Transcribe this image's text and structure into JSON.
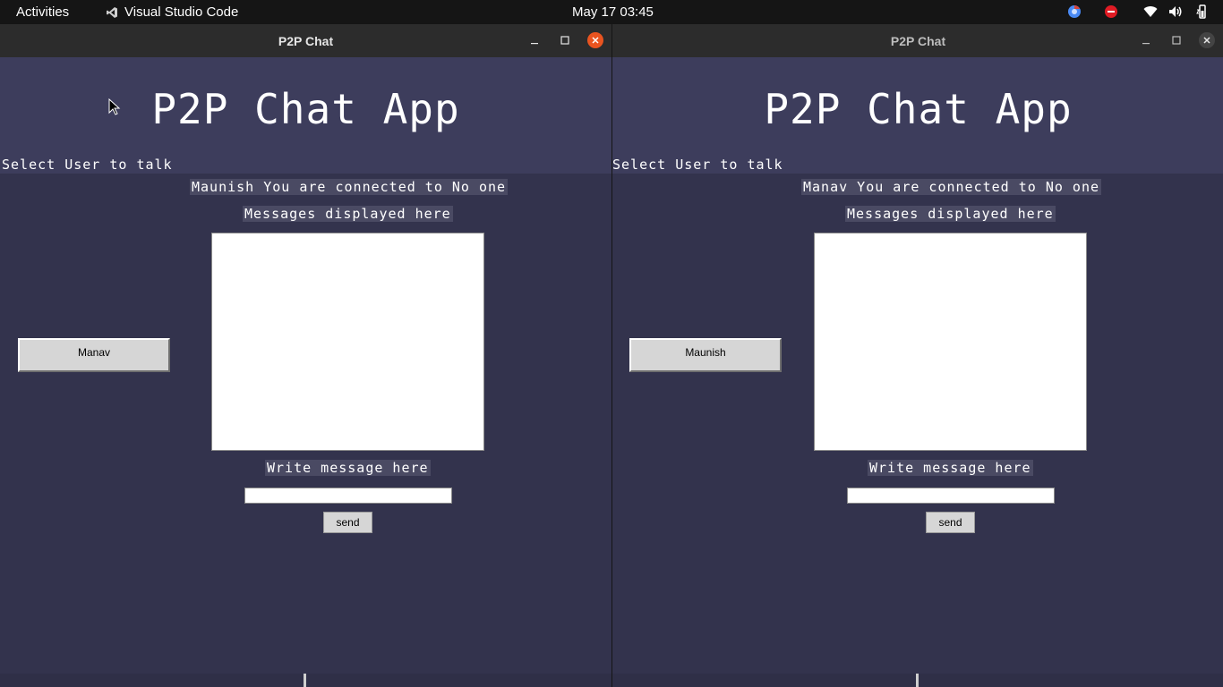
{
  "topbar": {
    "activities": "Activities",
    "app_name": "Visual Studio Code",
    "clock": "May 17  03:45"
  },
  "windows": [
    {
      "title": "P2P Chat",
      "app_title": "P2P Chat App",
      "select_label": "Select User to talk",
      "status": "Maunish You are connected to No one",
      "messages_label": "Messages displayed here",
      "user_button": "Manav",
      "write_label": "Write message here",
      "message_input_value": "",
      "send_label": "send"
    },
    {
      "title": "P2P Chat",
      "app_title": "P2P Chat App",
      "select_label": "Select User to talk",
      "status": "Manav You are connected to No one",
      "messages_label": "Messages displayed here",
      "user_button": "Maunish",
      "write_label": "Write message here",
      "message_input_value": "",
      "send_label": "send"
    }
  ],
  "colors": {
    "background": "#33334d",
    "header": "#3d3d5c",
    "close_active": "#e95420",
    "topbar": "#151515"
  },
  "icons": {
    "app_icon": "vscode-icon",
    "tray": [
      "chrome-icon",
      "do-not-disturb-icon",
      "wifi-icon",
      "volume-icon",
      "battery-icon"
    ]
  }
}
